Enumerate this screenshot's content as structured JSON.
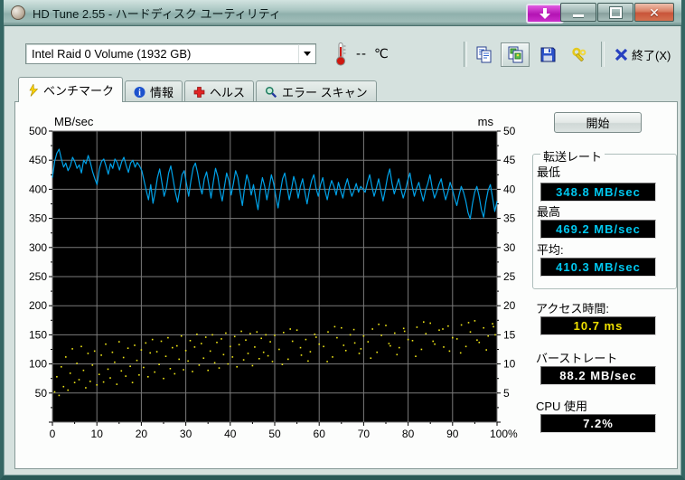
{
  "window": {
    "title": "HD Tune 2.55 - ハードディスク ユーティリティ"
  },
  "toolbar": {
    "drive_select": "Intel  Raid 0 Volume (1932 GB)",
    "temperature": "--",
    "temperature_unit": "℃",
    "exit_label": "終了(X)"
  },
  "tabs": [
    {
      "label": "ベンチマーク",
      "icon": "lightning-icon",
      "active": true
    },
    {
      "label": "情報",
      "icon": "info-icon",
      "active": false
    },
    {
      "label": "ヘルス",
      "icon": "health-icon",
      "active": false
    },
    {
      "label": "エラー スキャン",
      "icon": "scan-icon",
      "active": false
    }
  ],
  "results": {
    "start_label": "開始",
    "transfer_group": "転送レート",
    "min_label": "最低",
    "min_value": "348.8 MB/sec",
    "max_label": "最高",
    "max_value": "469.2 MB/sec",
    "avg_label": "平均:",
    "avg_value": "410.3 MB/sec",
    "access_label": "アクセス時間:",
    "access_value": "10.7 ms",
    "burst_label": "バーストレート",
    "burst_value": "88.2 MB/sec",
    "cpu_label": "CPU 使用",
    "cpu_value": "7.2%"
  },
  "chart_data": {
    "type": "line+scatter",
    "title": "",
    "left_axis": {
      "label": "MB/sec",
      "min": 0,
      "max": 500,
      "ticks": [
        500,
        450,
        400,
        350,
        300,
        250,
        200,
        150,
        100,
        50
      ]
    },
    "right_axis": {
      "label": "ms",
      "min": 0,
      "max": 50,
      "ticks": [
        50,
        45,
        40,
        35,
        30,
        25,
        20,
        15,
        10,
        5
      ]
    },
    "x_axis": {
      "min": 0,
      "max": 100,
      "tick_labels": [
        "0",
        "10",
        "20",
        "30",
        "40",
        "50",
        "60",
        "70",
        "80",
        "90",
        "100%"
      ]
    },
    "colors": {
      "line": "#00a2e8",
      "scatter": "#f0e616",
      "grid": "#7b7b7b",
      "bg": "#000000",
      "axis_text": "#000000"
    },
    "grid": true,
    "legend": "none",
    "transfer_rate_series": {
      "name": "transfer-rate-MB-per-sec",
      "x_range_percent": [
        0,
        100
      ],
      "values": [
        420,
        448,
        462,
        469,
        452,
        438,
        445,
        432,
        440,
        455,
        448,
        436,
        442,
        428,
        450,
        444,
        458,
        446,
        430,
        418,
        408,
        435,
        448,
        452,
        440,
        426,
        444,
        436,
        452,
        446,
        433,
        447,
        455,
        441,
        429,
        445,
        450,
        438,
        446,
        440,
        432,
        415,
        398,
        382,
        408,
        376,
        395,
        420,
        435,
        412,
        388,
        402,
        428,
        440,
        418,
        395,
        378,
        400,
        425,
        432,
        410,
        388,
        415,
        437,
        445,
        428,
        405,
        392,
        418,
        430,
        408,
        385,
        412,
        436,
        422,
        398,
        380,
        405,
        428,
        415,
        390,
        410,
        432,
        420,
        395,
        372,
        402,
        425,
        412,
        390,
        408,
        385,
        365,
        398,
        420,
        405,
        382,
        402,
        425,
        410,
        388,
        368,
        395,
        418,
        428,
        405,
        382,
        400,
        422,
        408,
        385,
        405,
        418,
        395,
        375,
        398,
        415,
        425,
        402,
        388,
        408,
        420,
        398,
        382,
        402,
        415,
        405,
        390,
        412,
        398,
        385,
        405,
        418,
        402,
        388,
        398,
        410,
        395,
        405,
        400,
        395,
        412,
        425,
        405,
        388,
        402,
        418,
        398,
        380,
        400,
        422,
        435,
        410,
        392,
        405,
        418,
        400,
        385,
        398,
        415,
        428,
        405,
        388,
        402,
        412,
        395,
        380,
        398,
        410,
        425,
        402,
        385,
        395,
        408,
        418,
        398,
        382,
        395,
        412,
        400,
        385,
        372,
        390,
        405,
        395,
        380,
        360,
        349,
        375,
        395,
        405,
        388,
        365,
        352,
        378,
        398,
        408,
        385,
        362,
        380
      ]
    },
    "access_time_points": [
      [
        0.5,
        5.2
      ],
      [
        1,
        7.8
      ],
      [
        1.5,
        4.6
      ],
      [
        2,
        9.5
      ],
      [
        2.5,
        6.1
      ],
      [
        3,
        11.2
      ],
      [
        3.5,
        5.5
      ],
      [
        4,
        8.4
      ],
      [
        4.5,
        12.6
      ],
      [
        5,
        6.8
      ],
      [
        5.5,
        10.1
      ],
      [
        6,
        7.3
      ],
      [
        6.5,
        13.0
      ],
      [
        7,
        8.9
      ],
      [
        7.5,
        5.9
      ],
      [
        8,
        11.8
      ],
      [
        8.5,
        7.0
      ],
      [
        9,
        9.8
      ],
      [
        9.5,
        12.2
      ],
      [
        10,
        6.4
      ],
      [
        10.5,
        8.2
      ],
      [
        11,
        11.5
      ],
      [
        11.5,
        6.9
      ],
      [
        12,
        13.4
      ],
      [
        12.5,
        9.1
      ],
      [
        13,
        7.6
      ],
      [
        13.5,
        12.0
      ],
      [
        14,
        10.3
      ],
      [
        14.5,
        6.5
      ],
      [
        15,
        13.8
      ],
      [
        15.5,
        8.8
      ],
      [
        16,
        11.1
      ],
      [
        16.5,
        7.9
      ],
      [
        17,
        12.7
      ],
      [
        17.5,
        9.6
      ],
      [
        18,
        6.8
      ],
      [
        18.5,
        13.2
      ],
      [
        19,
        10.6
      ],
      [
        19.5,
        8.1
      ],
      [
        20,
        12.4
      ],
      [
        20.5,
        9.4
      ],
      [
        21,
        13.6
      ],
      [
        21.5,
        7.8
      ],
      [
        22,
        11.9
      ],
      [
        22.5,
        14.2
      ],
      [
        23,
        8.6
      ],
      [
        23.5,
        12.1
      ],
      [
        24,
        9.9
      ],
      [
        24.5,
        13.9
      ],
      [
        25,
        7.5
      ],
      [
        25.5,
        11.3
      ],
      [
        26,
        14.5
      ],
      [
        26.5,
        9.2
      ],
      [
        27,
        12.8
      ],
      [
        27.5,
        8.3
      ],
      [
        28,
        13.1
      ],
      [
        28.5,
        10.8
      ],
      [
        29,
        14.8
      ],
      [
        29.5,
        9.0
      ],
      [
        30,
        12.3
      ],
      [
        30.5,
        10.5
      ],
      [
        31,
        14.0
      ],
      [
        31.5,
        8.7
      ],
      [
        32,
        12.9
      ],
      [
        32.5,
        15.1
      ],
      [
        33,
        9.8
      ],
      [
        33.5,
        13.5
      ],
      [
        34,
        11.0
      ],
      [
        34.5,
        14.6
      ],
      [
        35,
        8.9
      ],
      [
        35.5,
        12.2
      ],
      [
        36,
        15.0
      ],
      [
        36.5,
        10.2
      ],
      [
        37,
        13.7
      ],
      [
        37.5,
        9.3
      ],
      [
        38,
        14.3
      ],
      [
        38.5,
        11.6
      ],
      [
        39,
        15.3
      ],
      [
        39.5,
        10.0
      ],
      [
        40,
        13.0
      ],
      [
        40.5,
        11.2
      ],
      [
        41,
        14.7
      ],
      [
        41.5,
        9.5
      ],
      [
        42,
        13.3
      ],
      [
        42.5,
        15.6
      ],
      [
        43,
        10.7
      ],
      [
        43.5,
        14.1
      ],
      [
        44,
        11.8
      ],
      [
        44.5,
        15.2
      ],
      [
        45,
        9.7
      ],
      [
        45.5,
        12.9
      ],
      [
        46,
        15.5
      ],
      [
        46.5,
        10.9
      ],
      [
        47,
        14.4
      ],
      [
        47.5,
        12.0
      ],
      [
        48,
        15.0
      ],
      [
        48.5,
        11.4
      ],
      [
        49,
        13.8
      ],
      [
        49.5,
        10.4
      ],
      [
        50,
        14.9
      ],
      [
        51,
        12.5
      ],
      [
        52,
        15.4
      ],
      [
        53,
        10.8
      ],
      [
        54,
        13.9
      ],
      [
        55,
        15.8
      ],
      [
        56,
        11.5
      ],
      [
        57,
        14.2
      ],
      [
        58,
        12.1
      ],
      [
        59,
        15.1
      ],
      [
        60,
        13.4
      ],
      [
        51.7,
        9.9
      ],
      [
        53.5,
        16.0
      ],
      [
        55.8,
        12.8
      ],
      [
        57.5,
        10.5
      ],
      [
        59.3,
        14.6
      ],
      [
        61,
        13.0
      ],
      [
        62,
        15.5
      ],
      [
        63,
        11.2
      ],
      [
        64,
        14.5
      ],
      [
        65,
        16.2
      ],
      [
        66,
        12.3
      ],
      [
        67,
        15.0
      ],
      [
        68,
        13.6
      ],
      [
        69,
        11.8
      ],
      [
        70,
        14.8
      ],
      [
        61.8,
        10.4
      ],
      [
        63.5,
        16.4
      ],
      [
        65.5,
        13.2
      ],
      [
        67.8,
        15.9
      ],
      [
        69.4,
        12.6
      ],
      [
        71,
        13.8
      ],
      [
        72,
        16.0
      ],
      [
        73,
        12.0
      ],
      [
        74,
        14.9
      ],
      [
        75,
        16.6
      ],
      [
        76,
        13.1
      ],
      [
        77,
        15.3
      ],
      [
        78,
        12.8
      ],
      [
        79,
        16.1
      ],
      [
        80,
        14.2
      ],
      [
        71.6,
        11.0
      ],
      [
        73.4,
        16.8
      ],
      [
        75.7,
        13.5
      ],
      [
        77.5,
        11.6
      ],
      [
        79.2,
        15.6
      ],
      [
        81,
        14.0
      ],
      [
        82,
        16.3
      ],
      [
        83,
        12.5
      ],
      [
        84,
        15.2
      ],
      [
        85,
        17.0
      ],
      [
        86,
        13.4
      ],
      [
        87,
        15.8
      ],
      [
        88,
        12.9
      ],
      [
        89,
        16.5
      ],
      [
        90,
        14.5
      ],
      [
        81.7,
        11.3
      ],
      [
        83.5,
        17.2
      ],
      [
        85.6,
        13.9
      ],
      [
        87.8,
        16.0
      ],
      [
        89.3,
        12.2
      ],
      [
        91,
        14.3
      ],
      [
        92,
        16.7
      ],
      [
        93,
        13.0
      ],
      [
        94,
        15.5
      ],
      [
        95,
        17.4
      ],
      [
        96,
        13.7
      ],
      [
        97,
        16.2
      ],
      [
        98,
        14.8
      ],
      [
        99,
        16.9
      ],
      [
        99.6,
        15.0
      ],
      [
        91.8,
        11.9
      ],
      [
        93.6,
        17.1
      ],
      [
        95.5,
        14.1
      ],
      [
        97.6,
        12.4
      ],
      [
        99.2,
        16.4
      ]
    ]
  }
}
